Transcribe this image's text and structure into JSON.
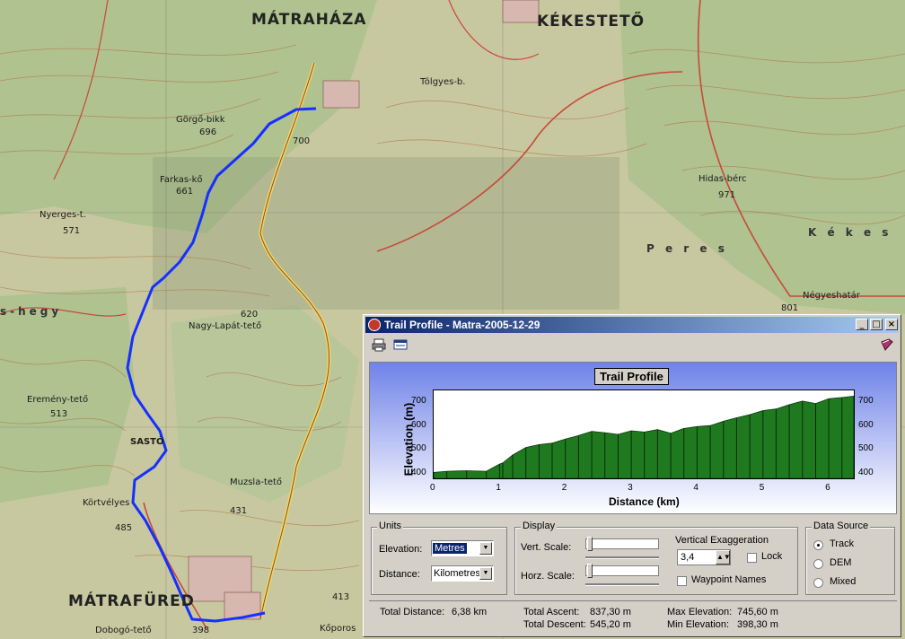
{
  "map": {
    "labels": {
      "matrahaza": "MÁTRAHÁZA",
      "kekesteto": "KÉKESTETŐ",
      "matrafured": "MÁTRAFÜRED",
      "sasto": "SASTÓ",
      "gorgo_bikk": "Görgő-bikk",
      "gorgo_bikk_elev": "696",
      "farkas_ko": "Farkas-kő",
      "farkas_elev": "661",
      "nyerges": "Nyerges-t.",
      "nyerges_elev": "571",
      "eremeny": "Eremény-tető",
      "eremeny_elev": "513",
      "kortvelyes": "Körtvélyes",
      "kortvelyes_elev": "485",
      "nagy_lapat": "Nagy-Lapát-tető",
      "nagy_lapat_elev": "620",
      "hidas_berc": "Hidas-bérc",
      "hidas_elev": "971",
      "negyeshatar": "Négyeshatár",
      "muzsla": "Muzsla-tető",
      "muzsla_elev": "431",
      "peres": "P e r e s",
      "kekes": "K é k e s",
      "tolgyes": "Tölgyes-b.",
      "kishegy": "s-hegy",
      "dobogo": "Dobogó-tető",
      "kokoros": "Kőporos",
      "elev_413": "413",
      "elev_398": "398",
      "elev_700": "700",
      "elev_801": "801"
    }
  },
  "window": {
    "title": "Trail Profile - Matra-2005-12-29",
    "minimize": "_",
    "maximize": "□",
    "close": "×"
  },
  "chart_data": {
    "type": "area",
    "title": "Trail Profile",
    "xlabel": "Distance (km)",
    "ylabel": "Elevation (m)",
    "xlim": [
      0,
      6.38
    ],
    "ylim": [
      380,
      750
    ],
    "x_ticks": [
      "0",
      "1",
      "2",
      "3",
      "4",
      "5",
      "6"
    ],
    "y_ticks": [
      "400",
      "500",
      "600",
      "700"
    ],
    "fill_color": "#1f7a1f",
    "x": [
      0,
      0.2,
      0.5,
      0.8,
      1.0,
      1.05,
      1.2,
      1.4,
      1.6,
      1.8,
      2.0,
      2.2,
      2.4,
      2.6,
      2.8,
      3.0,
      3.2,
      3.4,
      3.6,
      3.8,
      4.0,
      4.2,
      4.4,
      4.6,
      4.8,
      5.0,
      5.2,
      5.4,
      5.6,
      5.8,
      6.0,
      6.2,
      6.38
    ],
    "y": [
      405,
      410,
      412,
      410,
      440,
      445,
      478,
      510,
      522,
      528,
      545,
      560,
      578,
      572,
      565,
      580,
      575,
      585,
      570,
      590,
      598,
      602,
      620,
      635,
      648,
      665,
      672,
      690,
      705,
      695,
      715,
      720,
      726
    ]
  },
  "units": {
    "legend": "Units",
    "elevation_label": "Elevation:",
    "elevation_value": "Metres",
    "distance_label": "Distance:",
    "distance_value": "Kilometres"
  },
  "display": {
    "legend": "Display",
    "vert_scale": "Vert. Scale:",
    "horz_scale": "Horz. Scale:",
    "vert_exag_label": "Vertical Exaggeration",
    "vert_exag_value": "3,4",
    "lock": "Lock",
    "waypoint_names": "Waypoint Names"
  },
  "data_source": {
    "legend": "Data Source",
    "options": [
      "Track",
      "DEM",
      "Mixed"
    ],
    "selected": "Track"
  },
  "stats": {
    "total_distance_label": "Total Distance:",
    "total_distance": "6,38 km",
    "total_ascent_label": "Total Ascent:",
    "total_ascent": "837,30 m",
    "total_descent_label": "Total Descent:",
    "total_descent": "545,20 m",
    "max_elev_label": "Max Elevation:",
    "max_elev": "745,60 m",
    "min_elev_label": "Min Elevation:",
    "min_elev": "398,30 m"
  }
}
